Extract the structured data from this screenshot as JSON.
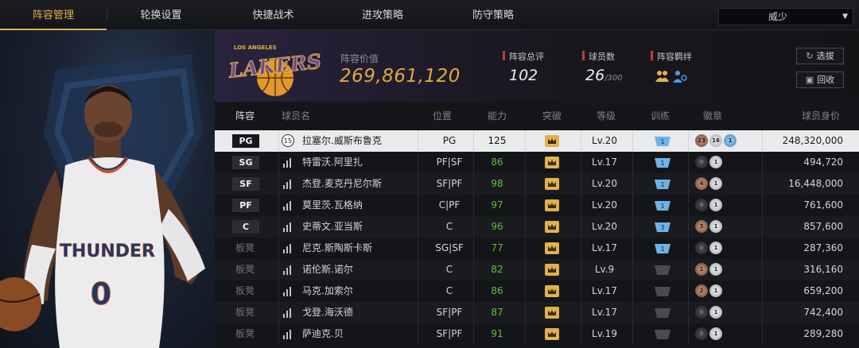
{
  "nav": {
    "tabs": [
      "阵容管理",
      "轮换设置",
      "快捷战术",
      "进攻策略",
      "防守策略"
    ],
    "active_tab": 0,
    "dropdown_value": "威少"
  },
  "hero": {
    "jersey_text": "THUNDER",
    "jersey_number": "0"
  },
  "summary": {
    "team_logo_text": "LAKERS",
    "team_logo_subtext": "LOS ANGELES",
    "lineup_value_label": "阵容价值",
    "lineup_value": "269,861,120",
    "rating_label": "阵容总评",
    "rating_value": "102",
    "player_count_label": "球员数",
    "player_count_value": "26",
    "player_count_max": "/300",
    "bond_label": "阵容羁绊",
    "select_button": "选拔",
    "recycle_button": "回收"
  },
  "colors": {
    "accent": "#e2b04c",
    "power_green": "#5fbf3a",
    "red_marker": "#c8383a",
    "lakers_purple": "#5b3f8c"
  },
  "table": {
    "headers": [
      "阵容",
      "球员名",
      "位置",
      "能力",
      "突破",
      "等级",
      "训练",
      "徽章",
      "球员身价"
    ],
    "rows": [
      {
        "slot": "PG",
        "bench": false,
        "number": "15",
        "name": "拉塞尔.威斯布鲁克",
        "position": "PG",
        "power": "125",
        "level": "Lv.20",
        "train": "1",
        "badges": [
          "23",
          "16",
          "1"
        ],
        "badge_colors": [
          "bronze",
          "silver",
          "blue"
        ],
        "value": "248,320,000",
        "selected": true
      },
      {
        "slot": "SG",
        "bench": false,
        "name": "特雷沃.阿里扎",
        "position": "PF|SF",
        "power": "86",
        "level": "Lv.17",
        "train": "1",
        "badges": [
          "0",
          "1"
        ],
        "badge_colors": [
          "dark",
          "silver"
        ],
        "value": "494,720"
      },
      {
        "slot": "SF",
        "bench": false,
        "name": "杰登.麦克丹尼尔斯",
        "position": "SF|PF",
        "power": "98",
        "level": "Lv.20",
        "train": "1",
        "badges": [
          "4",
          "1"
        ],
        "badge_colors": [
          "bronze",
          "silver"
        ],
        "value": "16,448,000"
      },
      {
        "slot": "PF",
        "bench": false,
        "name": "莫里茨.瓦格纳",
        "position": "C|PF",
        "power": "97",
        "level": "Lv.20",
        "train": "1",
        "badges": [
          "0",
          "1"
        ],
        "badge_colors": [
          "dark",
          "silver"
        ],
        "value": "761,600"
      },
      {
        "slot": "C",
        "bench": false,
        "name": "史蒂文.亚当斯",
        "position": "C",
        "power": "96",
        "level": "Lv.20",
        "train": "3",
        "badges": [
          "3",
          "1"
        ],
        "badge_colors": [
          "bronze",
          "silver"
        ],
        "value": "857,600"
      },
      {
        "slot": "板凳",
        "bench": true,
        "name": "尼克.斯陶斯卡斯",
        "position": "SG|SF",
        "power": "77",
        "level": "Lv.17",
        "train": "1",
        "badges": [
          "0",
          "1"
        ],
        "badge_colors": [
          "dark",
          "silver"
        ],
        "value": "287,360"
      },
      {
        "slot": "板凳",
        "bench": true,
        "name": "诺伦斯.诺尔",
        "position": "C",
        "power": "82",
        "level": "Lv.9",
        "train": "",
        "badges": [
          "1",
          "1"
        ],
        "badge_colors": [
          "bronze",
          "silver"
        ],
        "value": "316,160"
      },
      {
        "slot": "板凳",
        "bench": true,
        "name": "马克.加索尔",
        "position": "C",
        "power": "86",
        "level": "Lv.17",
        "train": "",
        "badges": [
          "2",
          "1"
        ],
        "badge_colors": [
          "bronze",
          "silver"
        ],
        "value": "659,200"
      },
      {
        "slot": "板凳",
        "bench": true,
        "name": "戈登.海沃德",
        "position": "SF|PF",
        "power": "87",
        "level": "Lv.17",
        "train": "",
        "badges": [
          "0",
          "1"
        ],
        "badge_colors": [
          "dark",
          "silver"
        ],
        "value": "742,400"
      },
      {
        "slot": "板凳",
        "bench": true,
        "name": "萨迪克.贝",
        "position": "SF|PF",
        "power": "91",
        "level": "Lv.19",
        "train": "",
        "badges": [
          "0",
          "1"
        ],
        "badge_colors": [
          "dark",
          "silver"
        ],
        "value": "289,280"
      }
    ]
  }
}
